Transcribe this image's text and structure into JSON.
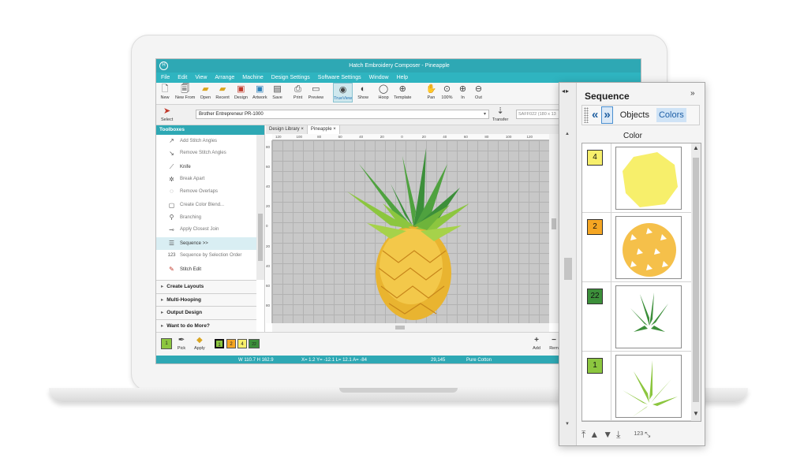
{
  "app": {
    "title": "Hatch Embroidery Composer - Pineapple",
    "logo_letter": "H"
  },
  "menu": [
    "File",
    "Edit",
    "View",
    "Arrange",
    "Machine",
    "Design Settings",
    "Software Settings",
    "Window",
    "Help"
  ],
  "toolbar": {
    "items": [
      {
        "label": "New",
        "icon": "new-icon"
      },
      {
        "label": "New From",
        "icon": "new-from-icon"
      },
      {
        "label": "Open",
        "icon": "open-icon"
      },
      {
        "label": "Recent",
        "icon": "recent-icon"
      },
      {
        "label": "Design",
        "icon": "design-icon"
      },
      {
        "label": "Artwork",
        "icon": "artwork-icon"
      },
      {
        "label": "Save",
        "icon": "save-icon"
      },
      {
        "label": "Print",
        "icon": "print-icon"
      },
      {
        "label": "Preview",
        "icon": "preview-icon"
      },
      {
        "label": "TrueView",
        "icon": "trueview-icon"
      },
      {
        "label": "Show",
        "icon": "show-icon"
      },
      {
        "label": "Hoop",
        "icon": "hoop-icon"
      },
      {
        "label": "Template",
        "icon": "template-icon"
      },
      {
        "label": "Pan",
        "icon": "pan-icon"
      },
      {
        "label": "100%",
        "icon": "zoom-100-icon"
      },
      {
        "label": "In",
        "icon": "zoom-in-icon"
      },
      {
        "label": "Out",
        "icon": "zoom-out-icon"
      }
    ]
  },
  "options": {
    "select_label": "Select",
    "machine": "Brother Entrepreneur PR-1000",
    "transfer_label": "Transfer",
    "hoop": "SAFF022 (180 x 13"
  },
  "toolboxes": {
    "header": "Toolboxes",
    "tools": [
      {
        "label": "Add Stitch Angles",
        "icon": "add-stitch-angles-icon"
      },
      {
        "label": "Remove Stitch Angles",
        "icon": "remove-stitch-angles-icon"
      },
      {
        "label": "Knife",
        "icon": "knife-icon"
      },
      {
        "label": "Break Apart",
        "icon": "break-apart-icon"
      },
      {
        "label": "Remove Overlaps",
        "icon": "remove-overlaps-icon"
      },
      {
        "label": "Create Color Blend...",
        "icon": "color-blend-icon"
      },
      {
        "label": "Branching",
        "icon": "branching-icon"
      },
      {
        "label": "Apply Closest Join",
        "icon": "closest-join-icon"
      },
      {
        "label": "Sequence >>",
        "icon": "sequence-icon"
      },
      {
        "label": "Sequence by Selection Order",
        "icon": "sequence-selection-icon"
      },
      {
        "label": "Stitch Edit",
        "icon": "stitch-edit-icon"
      }
    ],
    "groups": [
      "Create Layouts",
      "Multi-Hooping",
      "Output Design",
      "Want to do More?"
    ]
  },
  "doc_tabs": [
    {
      "label": "Design Library",
      "close": "×"
    },
    {
      "label": "Pineapple",
      "close": "×"
    }
  ],
  "rulers": {
    "top": [
      "120",
      "100",
      "80",
      "60",
      "40",
      "20",
      "0",
      "20",
      "40",
      "60",
      "80",
      "100",
      "120"
    ],
    "left": [
      "80",
      "60",
      "40",
      "20",
      "0",
      "20",
      "40",
      "60",
      "80"
    ]
  },
  "colorbar": {
    "current_swatch": "1",
    "pick_label": "Pick",
    "apply_label": "Apply",
    "swatches": [
      {
        "num": "1",
        "color": "#8cc63f"
      },
      {
        "num": "2",
        "color": "#f5a623"
      },
      {
        "num": "4",
        "color": "#f7ef6b"
      },
      {
        "num": "22",
        "color": "#3c8f3a"
      }
    ],
    "add_label": "Add",
    "remove_label": "Rem"
  },
  "status": {
    "size": "W 110.7 H 162.9",
    "coords": "X=   1.2 Y=  -12.1 L=  12.1 A=  -84",
    "stitches": "29,145",
    "fabric": "Pure Cotton"
  },
  "sequence": {
    "title": "Sequence",
    "expand": "»",
    "nav_first": "«",
    "nav_last": "»",
    "tabs": [
      "Objects",
      "Colors"
    ],
    "column": "Color",
    "rows": [
      {
        "num": "4",
        "color": "#f7ef6b",
        "thumb": "yellow-blob"
      },
      {
        "num": "2",
        "color": "#f5a623",
        "thumb": "orange-pattern"
      },
      {
        "num": "22",
        "color": "#3c8f3a",
        "thumb": "dark-green-leaves"
      },
      {
        "num": "1",
        "color": "#8cc63f",
        "thumb": "light-green-leaves"
      }
    ],
    "footer_num": "123"
  },
  "colors": {
    "accent": "#2ea8b4",
    "canvas": "#c8c8c8"
  }
}
